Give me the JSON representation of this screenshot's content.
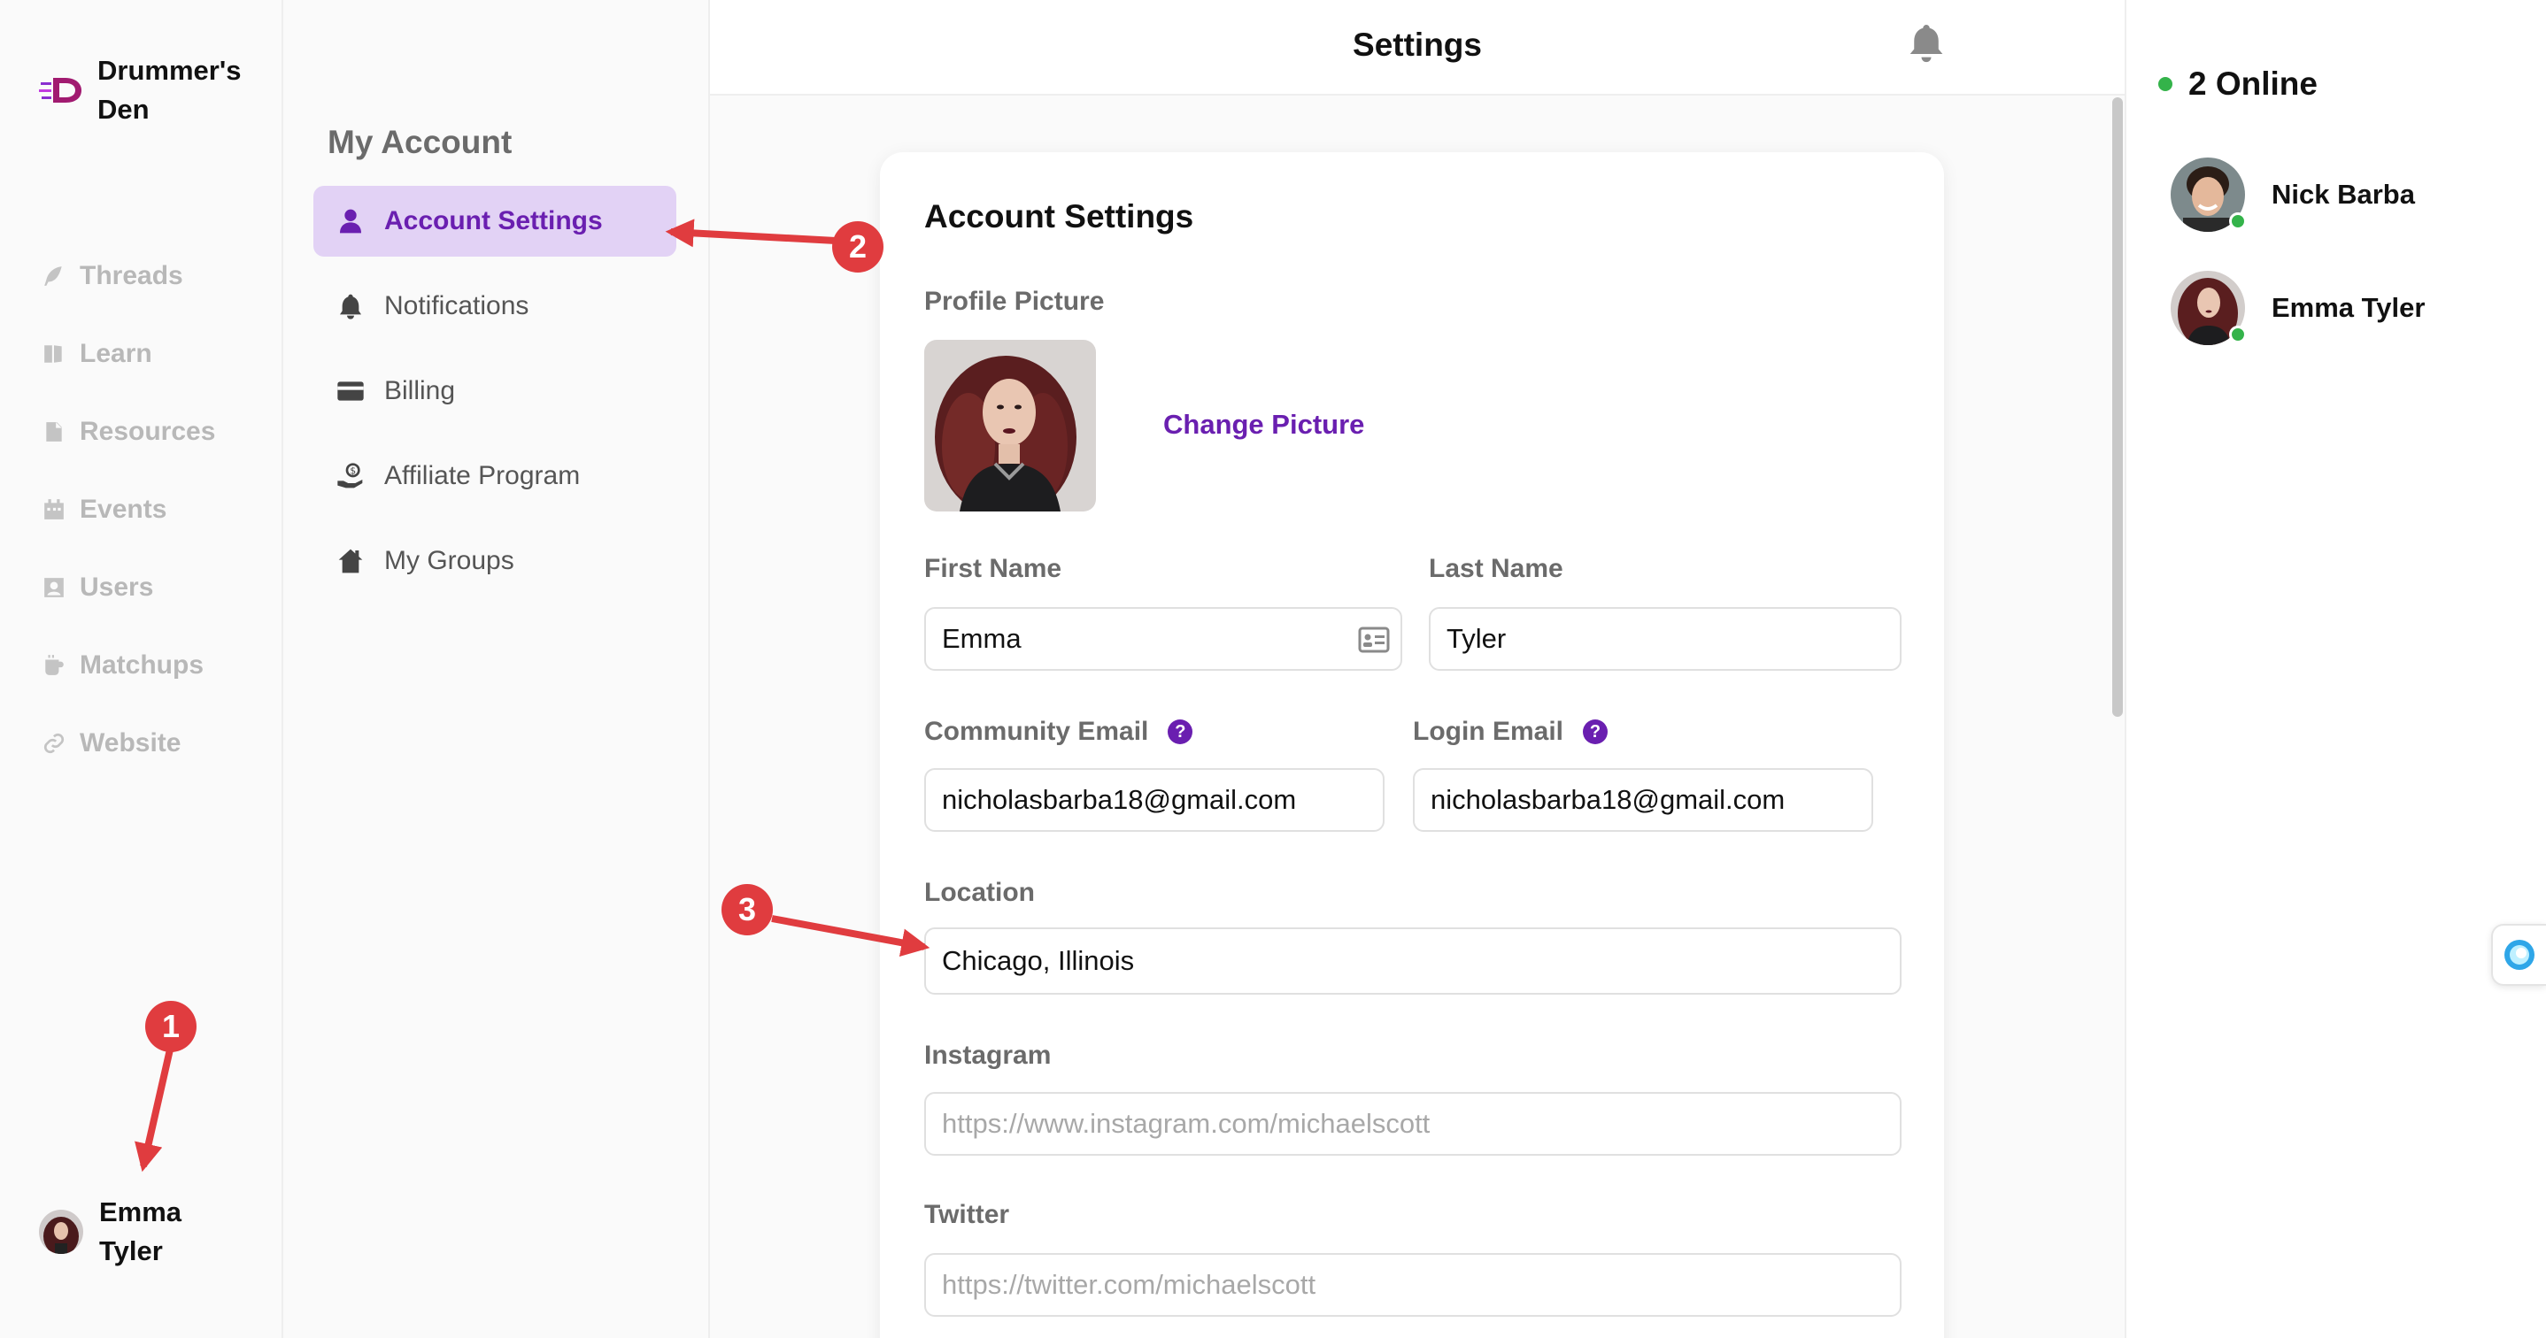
{
  "brand": {
    "name": "Drummer's Den"
  },
  "nav": {
    "items": [
      {
        "label": "Threads",
        "icon": "feather-icon"
      },
      {
        "label": "Learn",
        "icon": "book-icon"
      },
      {
        "label": "Resources",
        "icon": "document-icon"
      },
      {
        "label": "Events",
        "icon": "calendar-icon"
      },
      {
        "label": "Users",
        "icon": "user-card-icon"
      },
      {
        "label": "Matchups",
        "icon": "mug-icon"
      },
      {
        "label": "Website",
        "icon": "link-icon"
      }
    ]
  },
  "current_user": {
    "name": "Emma Tyler"
  },
  "account_menu": {
    "title": "My Account",
    "items": [
      {
        "label": "Account Settings",
        "icon": "user-icon",
        "active": true
      },
      {
        "label": "Notifications",
        "icon": "bell-icon",
        "active": false
      },
      {
        "label": "Billing",
        "icon": "credit-card-icon",
        "active": false
      },
      {
        "label": "Affiliate Program",
        "icon": "hand-coin-icon",
        "active": false
      },
      {
        "label": "My Groups",
        "icon": "house-icon",
        "active": false
      }
    ]
  },
  "header": {
    "title": "Settings"
  },
  "form": {
    "title": "Account Settings",
    "profile_picture_label": "Profile Picture",
    "change_picture_label": "Change Picture",
    "first_name": {
      "label": "First Name",
      "value": "Emma"
    },
    "last_name": {
      "label": "Last Name",
      "value": "Tyler"
    },
    "community_email": {
      "label": "Community Email",
      "value": "nicholasbarba18@gmail.com"
    },
    "login_email": {
      "label": "Login Email",
      "value": "nicholasbarba18@gmail.com"
    },
    "location": {
      "label": "Location",
      "value": "Chicago, Illinois"
    },
    "instagram": {
      "label": "Instagram",
      "value": "",
      "placeholder": "https://www.instagram.com/michaelscott"
    },
    "twitter": {
      "label": "Twitter",
      "value": "",
      "placeholder": "https://twitter.com/michaelscott"
    },
    "help_glyph": "?"
  },
  "online_panel": {
    "title": "2 Online",
    "users": [
      {
        "name": "Nick Barba"
      },
      {
        "name": "Emma Tyler"
      }
    ]
  },
  "annotations": [
    "1",
    "2",
    "3"
  ],
  "colors": {
    "accent": "#6a1fb0",
    "active_bg": "#e2d2f5",
    "online": "#34b34a",
    "annotation": "#e03c3f"
  }
}
